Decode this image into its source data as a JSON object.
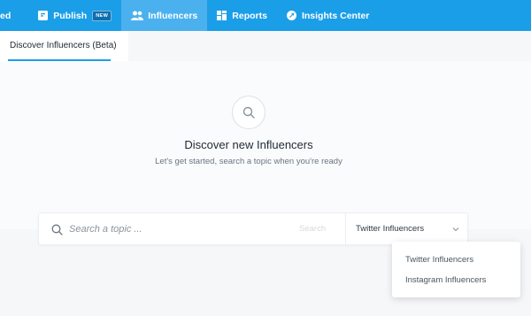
{
  "nav": {
    "items": [
      {
        "label": "ed",
        "icon": "none"
      },
      {
        "label": "Publish",
        "badge": "NEW",
        "icon": "publish-icon"
      },
      {
        "label": "Influencers",
        "icon": "influencers-icon"
      },
      {
        "label": "Reports",
        "icon": "reports-icon"
      },
      {
        "label": "Insights Center",
        "icon": "insights-icon"
      }
    ]
  },
  "subnav": {
    "tab": "Discover Influencers (Beta)"
  },
  "hero": {
    "title": "Discover new Influencers",
    "subtitle": "Let's get started, search a topic when you're ready"
  },
  "search": {
    "placeholder": "Search a topic ...",
    "button": "Search",
    "selected": "Twitter Influencers"
  },
  "dropdown": {
    "options": [
      "Twitter Influencers",
      "Instagram Influencers"
    ]
  },
  "colors": {
    "nav": "#1b9ee8",
    "nav_active": "#4bb1ee"
  }
}
